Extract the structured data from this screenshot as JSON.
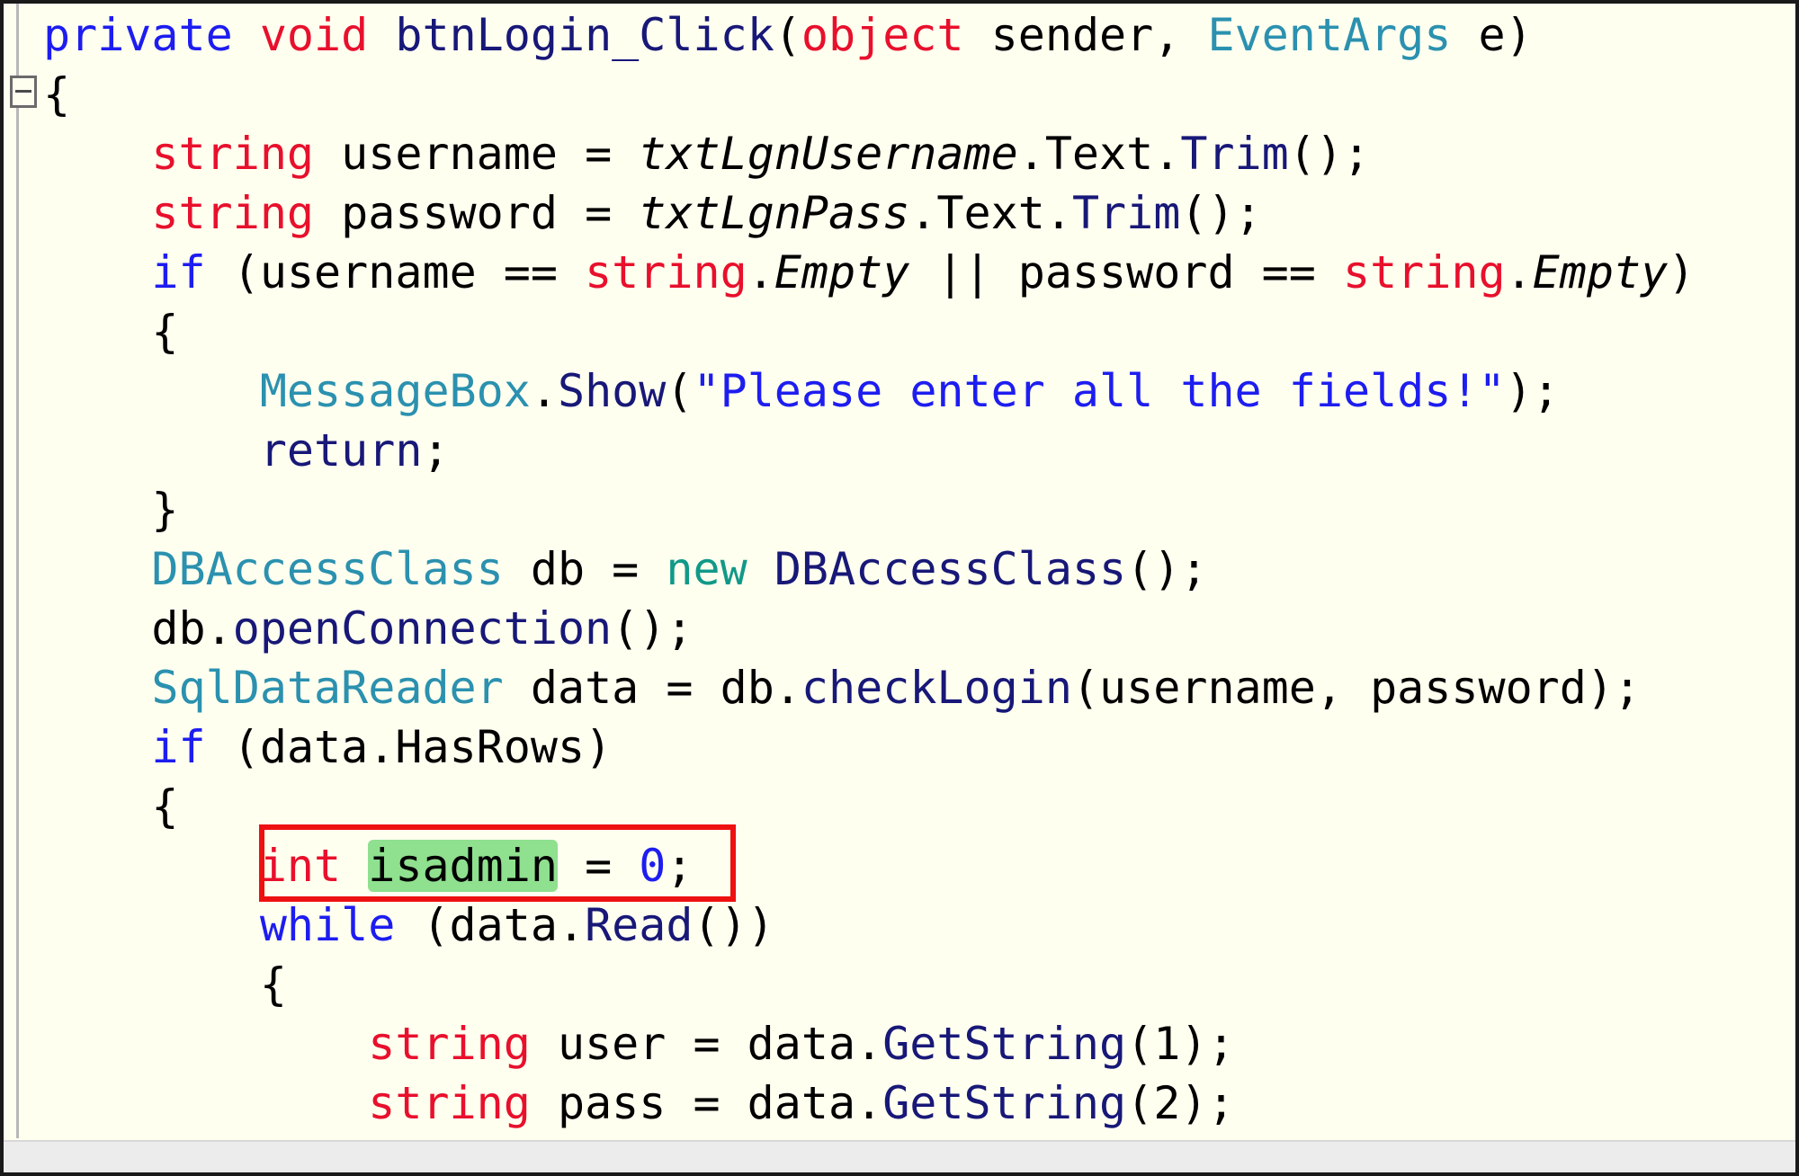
{
  "editor": {
    "lines": [
      {
        "tokens": [
          [
            "kw",
            "private"
          ],
          [
            "p",
            " "
          ],
          [
            "tp",
            "void"
          ],
          [
            "p",
            " "
          ],
          [
            "mth",
            "btnLogin_Click"
          ],
          [
            "p",
            "("
          ],
          [
            "tp",
            "object"
          ],
          [
            "p",
            " sender, "
          ],
          [
            "cls",
            "EventArgs"
          ],
          [
            "p",
            " e)"
          ]
        ]
      },
      {
        "tokens": [
          [
            "p",
            "{"
          ]
        ]
      },
      {
        "tokens": [
          [
            "p",
            "    "
          ],
          [
            "tp",
            "string"
          ],
          [
            "p",
            " username = "
          ],
          [
            "prop",
            "txtLgnUsername"
          ],
          [
            "p",
            ".Text."
          ],
          [
            "mth",
            "Trim"
          ],
          [
            "p",
            "();"
          ]
        ]
      },
      {
        "tokens": [
          [
            "p",
            "    "
          ],
          [
            "tp",
            "string"
          ],
          [
            "p",
            " password = "
          ],
          [
            "prop",
            "txtLgnPass"
          ],
          [
            "p",
            ".Text."
          ],
          [
            "mth",
            "Trim"
          ],
          [
            "p",
            "();"
          ]
        ]
      },
      {
        "tokens": [
          [
            "p",
            "    "
          ],
          [
            "kw",
            "if"
          ],
          [
            "p",
            " (username == "
          ],
          [
            "tp",
            "string"
          ],
          [
            "p",
            "."
          ],
          [
            "prop",
            "Empty"
          ],
          [
            "p",
            " || password == "
          ],
          [
            "tp",
            "string"
          ],
          [
            "p",
            "."
          ],
          [
            "prop",
            "Empty"
          ],
          [
            "p",
            ")"
          ]
        ]
      },
      {
        "tokens": [
          [
            "p",
            "    {"
          ]
        ]
      },
      {
        "tokens": [
          [
            "p",
            "        "
          ],
          [
            "cls",
            "MessageBox"
          ],
          [
            "p",
            "."
          ],
          [
            "mth",
            "Show"
          ],
          [
            "p",
            "("
          ],
          [
            "str",
            "\"Please enter all the fields!\""
          ],
          [
            "p",
            ");"
          ]
        ]
      },
      {
        "tokens": [
          [
            "p",
            "        "
          ],
          [
            "mth",
            "return"
          ],
          [
            "p",
            ";"
          ]
        ]
      },
      {
        "tokens": [
          [
            "p",
            "    }"
          ]
        ]
      },
      {
        "tokens": [
          [
            "p",
            "    "
          ],
          [
            "cls",
            "DBAccessClass"
          ],
          [
            "p",
            " db = "
          ],
          [
            "newkw",
            "new"
          ],
          [
            "p",
            " "
          ],
          [
            "mth",
            "DBAccessClass"
          ],
          [
            "p",
            "();"
          ]
        ]
      },
      {
        "tokens": [
          [
            "p",
            "    db."
          ],
          [
            "mth",
            "openConnection"
          ],
          [
            "p",
            "();"
          ]
        ]
      },
      {
        "tokens": [
          [
            "p",
            "    "
          ],
          [
            "cls",
            "SqlDataReader"
          ],
          [
            "p",
            " data = db."
          ],
          [
            "mth",
            "checkLogin"
          ],
          [
            "p",
            "(username, password);"
          ]
        ]
      },
      {
        "tokens": [
          [
            "p",
            "    "
          ],
          [
            "kw",
            "if"
          ],
          [
            "p",
            " (data.HasRows)"
          ]
        ]
      },
      {
        "tokens": [
          [
            "p",
            "    {"
          ]
        ]
      },
      {
        "tokens": [
          [
            "p",
            "        "
          ],
          [
            "tp",
            "int"
          ],
          [
            "p",
            " "
          ],
          [
            "ref",
            "isadmin"
          ],
          [
            "p",
            " = "
          ],
          [
            "num",
            "0"
          ],
          [
            "p",
            ";"
          ]
        ]
      },
      {
        "tokens": [
          [
            "p",
            "        "
          ],
          [
            "kw",
            "while"
          ],
          [
            "p",
            " (data."
          ],
          [
            "mth",
            "Read"
          ],
          [
            "p",
            "())"
          ]
        ]
      },
      {
        "tokens": [
          [
            "p",
            "        {"
          ]
        ]
      },
      {
        "tokens": [
          [
            "p",
            "            "
          ],
          [
            "tp",
            "string"
          ],
          [
            "p",
            " user = data."
          ],
          [
            "mth",
            "GetString"
          ],
          [
            "p",
            "(1);"
          ]
        ]
      },
      {
        "tokens": [
          [
            "p",
            "            "
          ],
          [
            "tp",
            "string"
          ],
          [
            "p",
            " pass = data."
          ],
          [
            "mth",
            "GetString"
          ],
          [
            "p",
            "(2);"
          ]
        ]
      }
    ]
  }
}
